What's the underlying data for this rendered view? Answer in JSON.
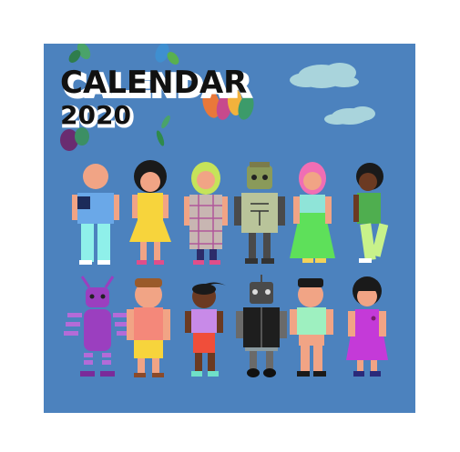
{
  "cover": {
    "title": "CALENDAR",
    "year": "2020",
    "background_color": "#4c82be",
    "title_color": "#111111",
    "title_shadow_color": "#ffffff"
  },
  "figures": [
    {
      "name": "figure-bald-kid",
      "row": 1
    },
    {
      "name": "figure-curly-hair-girl",
      "row": 1
    },
    {
      "name": "figure-green-hijab-girl",
      "row": 1
    },
    {
      "name": "figure-green-robot",
      "row": 1
    },
    {
      "name": "figure-pink-hijab-girl",
      "row": 1
    },
    {
      "name": "figure-dark-skin-kid",
      "row": 1
    },
    {
      "name": "figure-purple-robot",
      "row": 2
    },
    {
      "name": "figure-pink-shirt-kid",
      "row": 2
    },
    {
      "name": "figure-ponytail-girl",
      "row": 2
    },
    {
      "name": "figure-black-robot",
      "row": 2
    },
    {
      "name": "figure-mint-shirt-boy",
      "row": 2
    },
    {
      "name": "figure-purple-dress-girl",
      "row": 2
    }
  ]
}
